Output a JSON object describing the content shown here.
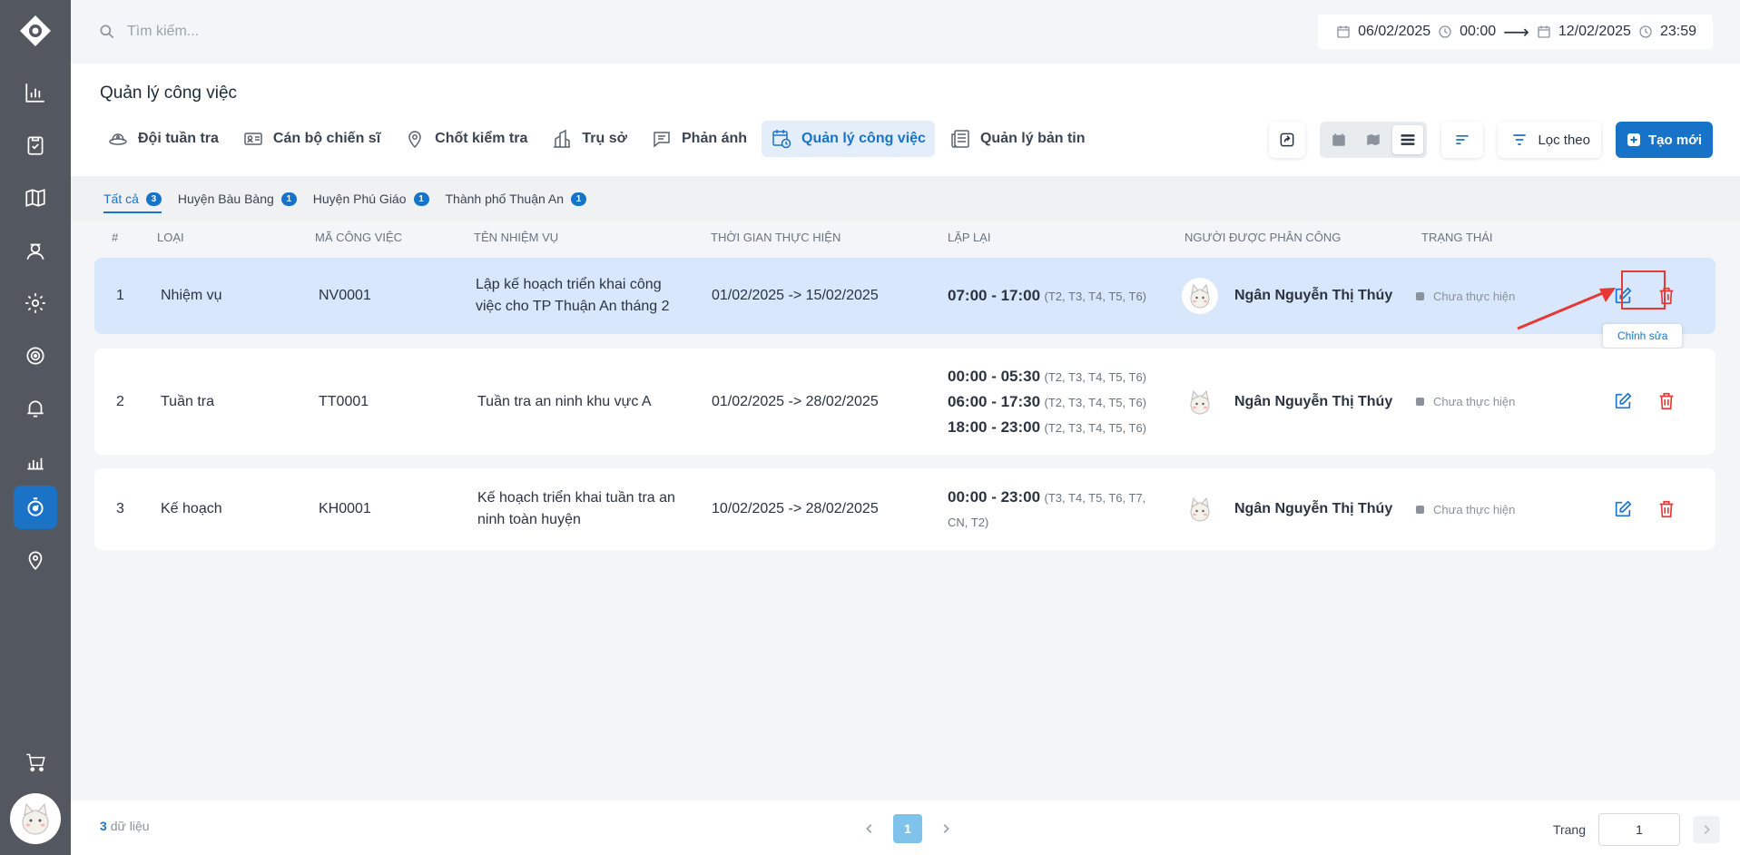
{
  "search": {
    "placeholder": "Tìm kiếm..."
  },
  "date_range": {
    "start_date": "06/02/2025",
    "start_time": "00:00",
    "arrow": "⟶",
    "end_date": "12/02/2025",
    "end_time": "23:59"
  },
  "page": {
    "title": "Quản lý công việc"
  },
  "tabs": [
    {
      "label": "Đội tuần tra",
      "icon": "patrol-hat-icon"
    },
    {
      "label": "Cán bộ chiến sĩ",
      "icon": "id-card-icon"
    },
    {
      "label": "Chốt kiểm tra",
      "icon": "map-pin-icon"
    },
    {
      "label": "Trụ sở",
      "icon": "building-icon"
    },
    {
      "label": "Phản ánh",
      "icon": "chat-icon"
    },
    {
      "label": "Quản lý công việc",
      "icon": "calendar-clock-icon"
    },
    {
      "label": "Quản lý bản tin",
      "icon": "newspaper-icon"
    }
  ],
  "toolbar": {
    "filter_label": "Lọc theo",
    "create_label": "Tạo mới"
  },
  "subtabs": [
    {
      "label": "Tất cả",
      "count": "3"
    },
    {
      "label": "Huyện Bàu Bàng",
      "count": "1"
    },
    {
      "label": "Huyện Phú Giáo",
      "count": "1"
    },
    {
      "label": "Thành phố Thuận An",
      "count": "1"
    }
  ],
  "table": {
    "headers": {
      "index": "#",
      "type": "Loại",
      "code": "Mã công việc",
      "name": "Tên nhiệm vụ",
      "period": "Thời gian thực hiện",
      "repeat": "Lặp lại",
      "assignee": "Người được phân công",
      "status": "Trạng thái"
    },
    "rows": [
      {
        "index": "1",
        "type": "Nhiệm vụ",
        "code": "NV0001",
        "name": "Lập kế hoạch triển khai công việc cho TP Thuận An tháng 2",
        "period": "01/02/2025 -> 15/02/2025",
        "schedule": [
          {
            "time": "07:00 - 17:00",
            "days": "(T2, T3, T4, T5, T6)"
          }
        ],
        "assignee": "Ngân Nguyễn Thị Thúy",
        "status": "Chưa thực hiện"
      },
      {
        "index": "2",
        "type": "Tuần tra",
        "code": "TT0001",
        "name": "Tuần tra an ninh khu vực A",
        "period": "01/02/2025 -> 28/02/2025",
        "schedule": [
          {
            "time": "00:00 - 05:30",
            "days": "(T2, T3, T4, T5, T6)"
          },
          {
            "time": "06:00 - 17:30",
            "days": "(T2, T3, T4, T5, T6)"
          },
          {
            "time": "18:00 - 23:00",
            "days": "(T2, T3, T4, T5, T6)"
          }
        ],
        "assignee": "Ngân Nguyễn Thị Thúy",
        "status": "Chưa thực hiện"
      },
      {
        "index": "3",
        "type": "Kế hoạch",
        "code": "KH0001",
        "name": "Kế hoạch triển khai tuần tra an ninh toàn huyện",
        "period": "10/02/2025 -> 28/02/2025",
        "schedule": [
          {
            "time": "00:00 - 23:00",
            "days": "(T3, T4, T5, T6, T7, CN, T2)"
          }
        ],
        "assignee": "Ngân Nguyễn Thị Thúy",
        "status": "Chưa thực hiện"
      }
    ],
    "edit_tooltip": "Chỉnh sửa"
  },
  "footer": {
    "total_count": "3",
    "total_label": "dữ liệu",
    "current_page": "1",
    "goto_label": "Trang",
    "goto_value": "1"
  },
  "colors": {
    "accent": "#1673c8",
    "sidebar": "#535860",
    "selected_row": "#d8e7fb",
    "delete": "#e53935",
    "annotation": "#e53935"
  }
}
